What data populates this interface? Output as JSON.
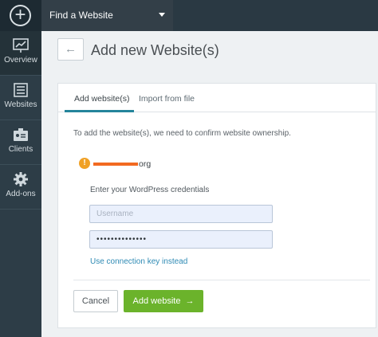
{
  "rail": {
    "add_symbol": "+",
    "items": [
      {
        "label": "Overview",
        "icon": "chart-icon"
      },
      {
        "label": "Websites",
        "icon": "list-icon"
      },
      {
        "label": "Clients",
        "icon": "id-card-icon"
      },
      {
        "label": "Add-ons",
        "icon": "gear-icon"
      }
    ]
  },
  "topbar": {
    "site_switch_label": "Find a Website"
  },
  "header": {
    "back_symbol": "←",
    "title": "Add new Website(s)"
  },
  "tabs": [
    {
      "label": "Add website(s)",
      "active": true
    },
    {
      "label": "Import from file",
      "active": false
    }
  ],
  "form": {
    "intro": "To add the website(s), we need to confirm website ownership.",
    "warning_symbol": "!",
    "site_suffix": "org",
    "credentials_label": "Enter your WordPress credentials",
    "username_placeholder": "Username",
    "username_value": "",
    "password_value": "••••••••••••••",
    "connection_key_link": "Use connection key instead"
  },
  "actions": {
    "cancel_label": "Cancel",
    "add_label": "Add website",
    "add_arrow": "→"
  },
  "colors": {
    "accent": "#24859b",
    "primary_button": "#6bb32b",
    "warning": "#f0a126",
    "link": "#2e8ab4",
    "rail": "#2d3d47"
  }
}
